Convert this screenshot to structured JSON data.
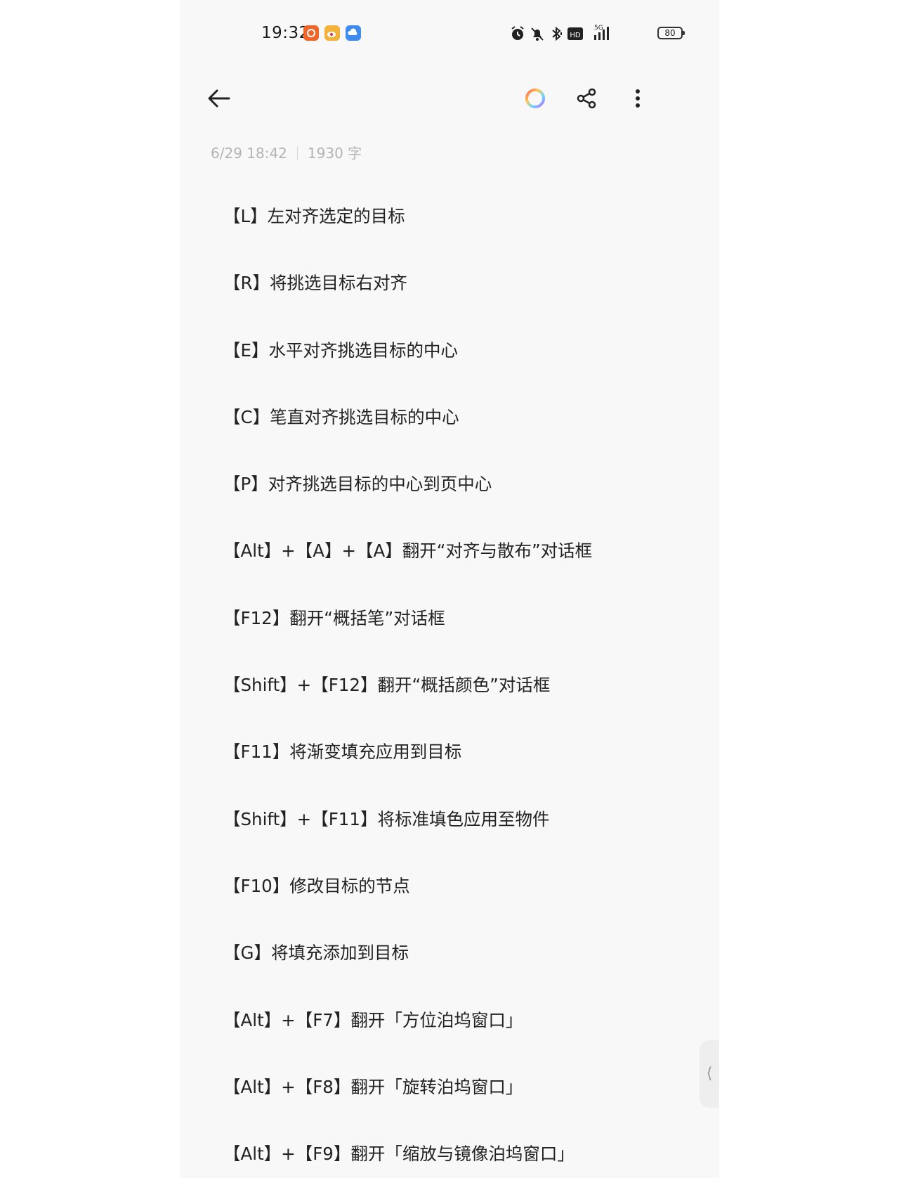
{
  "status_bar": {
    "time": "19:32",
    "battery": "80",
    "network": "5G",
    "hd_label": "HD"
  },
  "meta": {
    "datetime": "6/29 18:42",
    "word_count": "1930 字"
  },
  "lines": [
    "【L】左对齐选定的目标",
    "【R】将挑选目标右对齐",
    "【E】水平对齐挑选目标的中心",
    "【C】笔直对齐挑选目标的中心",
    "【P】对齐挑选目标的中心到页中心",
    "【Alt】+【A】+【A】翻开“对齐与散布”对话框",
    "【F12】翻开“概括笔”对话框",
    "【Shift】+【F12】翻开“概括颜色”对话框",
    "【F11】将渐变填充应用到目标",
    "【Shift】+【F11】将标准填色应用至物件",
    "【F10】修改目标的节点",
    "【G】将填充添加到目标",
    "【Alt】+【F7】翻开「方位泊坞窗口」",
    "【Alt】+【F8】翻开「旋转泊坞窗口」",
    "【Alt】+【F9】翻开「缩放与镜像泊坞窗口」"
  ],
  "colors": {
    "app1": "#f0662a",
    "app2": "#f3b23a",
    "app3": "#3f8cf0",
    "meta_text": "#b3b3b3",
    "body_text": "#222222",
    "background": "#f8f8f8"
  },
  "icons": {
    "back": "arrow-left-icon",
    "theme": "color-ring-icon",
    "share": "share-icon",
    "more": "more-vertical-icon",
    "edge": "chevron-left-icon"
  }
}
